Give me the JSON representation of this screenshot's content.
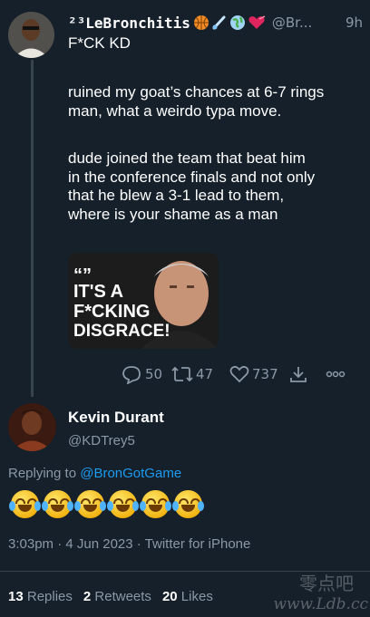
{
  "tweet1": {
    "display_name": "²³LeBronchitis",
    "handle": "@Br...",
    "time": "9h",
    "lines": [
      "F*CK KD",
      "",
      "ruined my goat’s chances at 6-7 rings",
      "man, what a weirdo typa move.",
      "",
      "dude joined the team that beat him",
      "in the conference finals and not only",
      "that he blew a 3-1 lead to them,",
      "where is your shame as a man"
    ],
    "image_text": [
      "“”",
      "IT'S A",
      "F*CKING",
      "DISGRACE!"
    ],
    "actions": {
      "replies": "50",
      "retweets": "47",
      "likes": "737"
    },
    "icons": [
      "basketball-icon",
      "comet-icon",
      "globe-icon",
      "heart-icon"
    ]
  },
  "tweet2": {
    "display_name": "Kevin Durant",
    "handle": "@KDTrey5",
    "replying_prefix": "Replying to",
    "replying_handle": "@BronGotGame",
    "emoji_count": 6,
    "emoji_name": "face-with-tears-of-joy",
    "meta": "3:03pm · 4 Jun 2023 · Twitter for iPhone",
    "stats": {
      "replies_num": "13",
      "replies_label": "Replies",
      "retweets_num": "2",
      "retweets_label": "Retweets",
      "likes_num": "20",
      "likes_label": "Likes"
    }
  },
  "watermark": {
    "top": "零点吧",
    "bottom": "www.Ldb.cc"
  },
  "colors": {
    "background": "#15202b",
    "text": "#ffffff",
    "muted": "#8b98a5",
    "accent": "#1d9bf0"
  }
}
